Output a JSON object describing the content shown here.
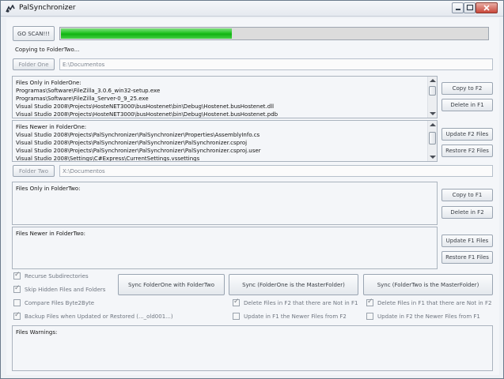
{
  "window": {
    "title": "PalSynchronizer"
  },
  "scan": {
    "button_label": "GO SCAN!!!",
    "progress": 0.4
  },
  "status_text": "Copying to FolderTwo...",
  "folder_one": {
    "button_label": "Folder One",
    "path": "E:\\Documentos"
  },
  "folder_two": {
    "button_label": "Folder Two",
    "path": "X:\\Documentos"
  },
  "lists": {
    "only_in_one": {
      "header": "Files Only in FolderOne:",
      "items": [
        "Programas\\Software\\FileZilla_3.0.6_win32-setup.exe",
        "Programas\\Software\\FileZilla_Server-0_9_25.exe",
        "Visual Studio 2008\\Projects\\HosteNET3000\\busHostenet\\bin\\Debug\\Hostenet.busHostenet.dll",
        "Visual Studio 2008\\Projects\\HosteNET3000\\busHostenet\\bin\\Debug\\Hostenet.busHostenet.pdb"
      ]
    },
    "newer_in_one": {
      "header": "Files Newer in FolderOne:",
      "items": [
        "Visual Studio 2008\\Projects\\PalSynchronizer\\PalSynchronizer\\Properties\\AssemblyInfo.cs",
        "Visual Studio 2008\\Projects\\PalSynchronizer\\PalSynchronizer\\PalSynchronizer.csproj",
        "Visual Studio 2008\\Projects\\PalSynchronizer\\PalSynchronizer\\PalSynchronizer.csproj.user",
        "Visual Studio 2008\\Settings\\C#Express\\CurrentSettings.vssettings"
      ]
    },
    "only_in_two": {
      "header": "Files Only in FolderTwo:",
      "items": []
    },
    "newer_in_two": {
      "header": "Files Newer in FolderTwo:",
      "items": []
    },
    "warnings": {
      "header": "Files Warnings:",
      "items": []
    }
  },
  "actions": {
    "copy_to_f2": "Copy to F2",
    "delete_in_f1": "Delete in F1",
    "update_f2_files": "Update F2 Files",
    "restore_f2_files": "Restore F2 Files",
    "copy_to_f1": "Copy to F1",
    "delete_in_f2": "Delete in F2",
    "update_f1_files": "Update F1 Files",
    "restore_f1_files": "Restore F1 Files"
  },
  "sync": {
    "both": "Sync FolderOne with FolderTwo",
    "one_master": "Sync (FolderOne is the MasterFolder)",
    "two_master": "Sync (FolderTwo is the MasterFolder)"
  },
  "options": {
    "recurse": {
      "label": "Recurse Subdirectories",
      "checked": true
    },
    "skip_hidden": {
      "label": "Skip Hidden Files and Folders",
      "checked": true
    },
    "compare_bytes": {
      "label": "Compare Files Byte2Byte",
      "checked": false
    },
    "backup": {
      "label": "Backup Files when Updated or Restored (..._old001...)",
      "checked": true
    },
    "delete_f2_not_f1": {
      "label": "Delete Files in F2 that there are Not in F1",
      "checked": true
    },
    "update_f1_newer_f2": {
      "label": "Update in F1 the Newer Files from F2",
      "checked": false
    },
    "delete_f1_not_f2": {
      "label": "Delete Files in F1 that there are Not in F2",
      "checked": true
    },
    "update_f2_newer_f1": {
      "label": "Update in F2 the Newer Files from F1",
      "checked": false
    }
  }
}
